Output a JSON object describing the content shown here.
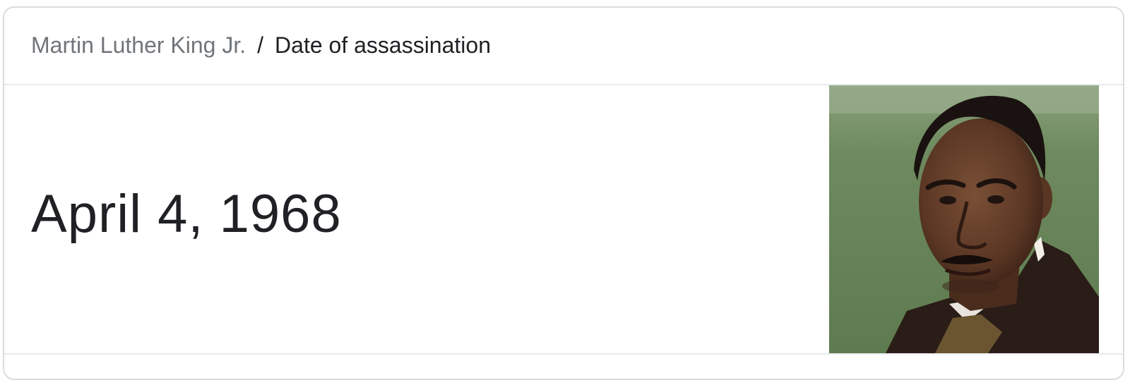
{
  "breadcrumb": {
    "parent": "Martin Luther King Jr.",
    "separator": "/",
    "current": "Date of assassination"
  },
  "answer": {
    "value": "April 4, 1968"
  },
  "photo": {
    "alt": "Martin Luther King Jr."
  }
}
